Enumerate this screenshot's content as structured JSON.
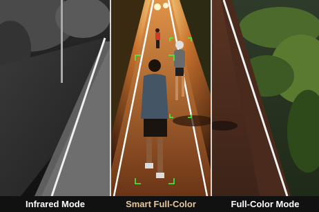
{
  "captions": {
    "infrared": "Infrared Mode",
    "smart": "Smart Full-Color",
    "full": "Full-Color Mode"
  },
  "colors": {
    "smart_caption": "#e6c79a",
    "caption_white": "#ffffff",
    "detection_box": "#39ff3b",
    "track_line": "#ffffff"
  },
  "icons": {
    "detection_frame": "target-bracket-icon"
  }
}
